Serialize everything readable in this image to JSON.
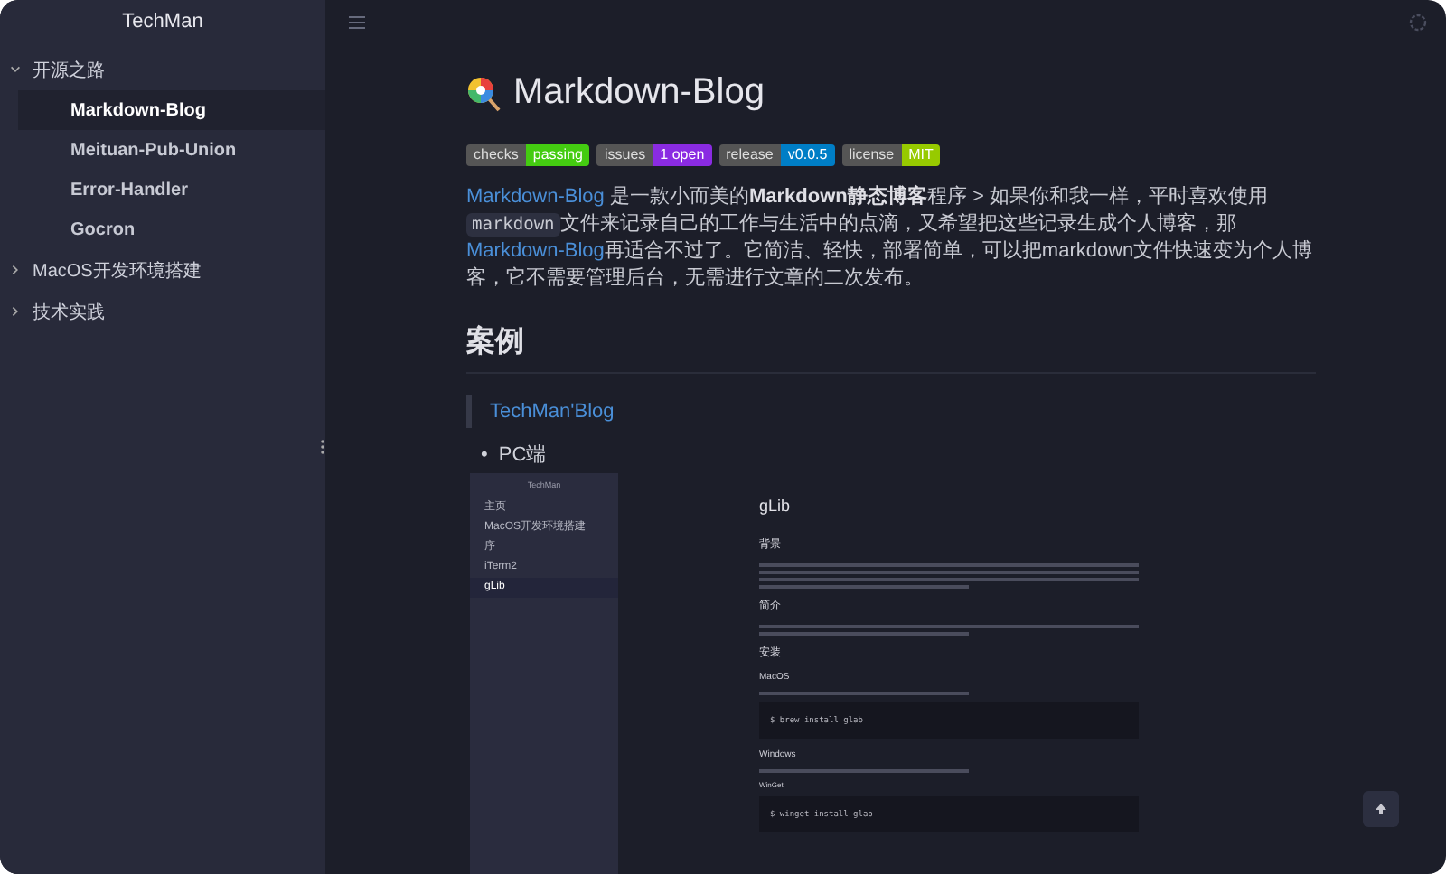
{
  "sidebar": {
    "title": "TechMan",
    "groups": [
      {
        "label": "开源之路",
        "expanded": true,
        "children": [
          {
            "label": "Markdown-Blog",
            "selected": true
          },
          {
            "label": "Meituan-Pub-Union",
            "selected": false
          },
          {
            "label": "Error-Handler",
            "selected": false
          },
          {
            "label": "Gocron",
            "selected": false
          }
        ]
      },
      {
        "label": "MacOS开发环境搭建",
        "expanded": false
      },
      {
        "label": "技术实践",
        "expanded": false
      }
    ]
  },
  "article": {
    "title": "Markdown-Blog",
    "badges": [
      {
        "label": "checks",
        "value": "passing",
        "color": "#44cc11"
      },
      {
        "label": "issues",
        "value": "1 open",
        "color": "#8a2be2"
      },
      {
        "label": "release",
        "value": "v0.0.5",
        "color": "#007ec6"
      },
      {
        "label": "license",
        "value": "MIT",
        "color": "#97ca00"
      }
    ],
    "intro": [
      {
        "kind": "link",
        "text": "Markdown-Blog"
      },
      {
        "kind": "text",
        "text": " 是一款小而美的"
      },
      {
        "kind": "bold",
        "text": "Markdown静态博客"
      },
      {
        "kind": "text",
        "text": "程序 > 如果你和我一样，平时喜欢使用"
      },
      {
        "kind": "code",
        "text": "markdown"
      },
      {
        "kind": "text",
        "text": "文件来记录自己的工作与生活中的点滴，又希望把这些记录生成个人博客，那"
      },
      {
        "kind": "link",
        "text": "Markdown-Blog"
      },
      {
        "kind": "text",
        "text": "再适合不过了。它简洁、轻快，部署简单，可以把markdown文件快速变为个人博客，它不需要管理后台，无需进行文章的二次发布。"
      }
    ],
    "section": "案例",
    "quote_link": "TechMan'Blog",
    "list": [
      {
        "bullet": "•",
        "text": "PC端"
      }
    ],
    "preview": {
      "title": "TechMan",
      "nav": [
        {
          "label": "主页",
          "selected": false
        },
        {
          "label": "MacOS开发环境搭建",
          "selected": false
        },
        {
          "label": "序",
          "selected": false
        },
        {
          "label": "iTerm2",
          "selected": false
        },
        {
          "label": "gLib",
          "selected": true
        }
      ],
      "heading": "gLib",
      "sections": [
        {
          "kind": "h2",
          "text": "背景"
        },
        {
          "kind": "line"
        },
        {
          "kind": "line"
        },
        {
          "kind": "line"
        },
        {
          "kind": "short_line"
        },
        {
          "kind": "h2",
          "text": "简介"
        },
        {
          "kind": "line"
        },
        {
          "kind": "short_line"
        },
        {
          "kind": "h2",
          "text": "安装"
        },
        {
          "kind": "h3",
          "text": "MacOS"
        },
        {
          "kind": "short_line"
        },
        {
          "kind": "code",
          "text": "$ brew install glab"
        },
        {
          "kind": "h3",
          "text": "Windows"
        },
        {
          "kind": "short_line"
        },
        {
          "kind": "h4",
          "text": "WinGet"
        },
        {
          "kind": "code",
          "text": "$ winget install glab"
        }
      ]
    }
  }
}
